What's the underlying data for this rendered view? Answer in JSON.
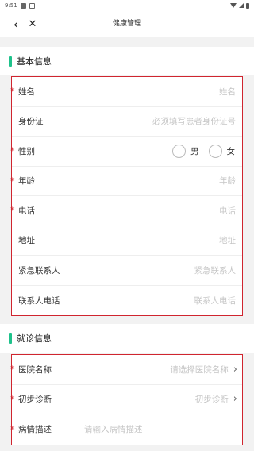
{
  "status_bar": {
    "time": "9:51"
  },
  "nav": {
    "title": "健康管理",
    "back": "‹",
    "close": "✕"
  },
  "basic_section": {
    "title": "基本信息"
  },
  "basic_fields": [
    {
      "label": "姓名",
      "placeholder": "姓名",
      "required": true
    },
    {
      "label": "身份证",
      "placeholder": "必须填写患者身份证号",
      "required": false
    },
    {
      "label": "性别",
      "required": true,
      "options": [
        "男",
        "女"
      ]
    },
    {
      "label": "年龄",
      "placeholder": "年龄",
      "required": true
    },
    {
      "label": "电话",
      "placeholder": "电话",
      "required": true
    },
    {
      "label": "地址",
      "placeholder": "地址",
      "required": false
    },
    {
      "label": "紧急联系人",
      "placeholder": "紧急联系人",
      "required": false
    },
    {
      "label": "联系人电话",
      "placeholder": "联系人电话",
      "required": false
    }
  ],
  "visit_section": {
    "title": "就诊信息"
  },
  "visit_fields": [
    {
      "label": "医院名称",
      "placeholder": "请选择医院名称",
      "required": true
    },
    {
      "label": "初步诊断",
      "placeholder": "初步诊断",
      "required": true
    },
    {
      "label": "病情描述",
      "placeholder": "请输入病情描述",
      "required": true
    }
  ],
  "required_mark": "*",
  "chevron": "›",
  "colors": {
    "accent": "#1ec28b",
    "required": "#d0252f",
    "placeholder": "#c6c6c6"
  }
}
